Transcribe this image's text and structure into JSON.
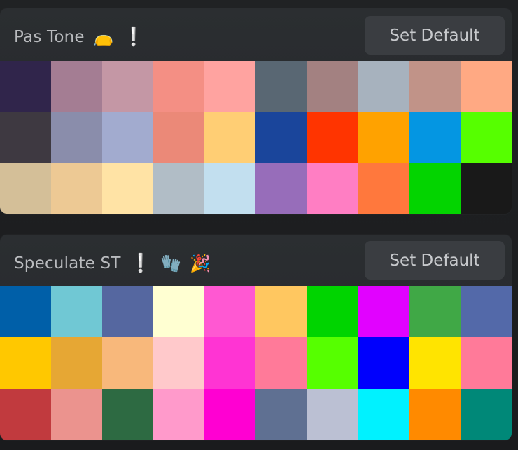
{
  "palettes": [
    {
      "title": "Pas Tone",
      "icons": [
        {
          "name": "bag-icon",
          "glyph": "👝"
        },
        {
          "name": "exclamation-icon",
          "glyph": "❕"
        }
      ],
      "button_label": "Set Default",
      "colors": [
        "#30254b",
        "#a47d93",
        "#c497a5",
        "#f48f84",
        "#ffa3a0",
        "#596773",
        "#a38181",
        "#a7b2be",
        "#c19388",
        "#ffa983",
        "#3e3941",
        "#8a8dab",
        "#a2abcf",
        "#eb8978",
        "#ffce74",
        "#1a459b",
        "#ff3400",
        "#ffa200",
        "#0496e2",
        "#56ff00",
        "#d4bf98",
        "#edc994",
        "#ffe3a5",
        "#b1bdc6",
        "#c2dfef",
        "#976dba",
        "#ff7ec3",
        "#ff783d",
        "#03d400",
        "#191919"
      ]
    },
    {
      "title": "Speculate ST",
      "icons": [
        {
          "name": "exclamation-icon",
          "glyph": "❕"
        },
        {
          "name": "glove-icon",
          "glyph": "🧤"
        },
        {
          "name": "party-popper-icon",
          "glyph": "🎉"
        }
      ],
      "button_label": "Set Default",
      "colors": [
        "#005fa8",
        "#70c8d4",
        "#5567a0",
        "#ffffd2",
        "#ff58d2",
        "#ffc760",
        "#00d400",
        "#e102ff",
        "#40a846",
        "#5369a9",
        "#ffc800",
        "#e6a734",
        "#f8b87b",
        "#ffc9cb",
        "#ff34d3",
        "#ff7a99",
        "#56ff00",
        "#0000fd",
        "#ffe400",
        "#ff7a99",
        "#c13a3e",
        "#eb938e",
        "#2d6a42",
        "#ff9acb",
        "#ff00d2",
        "#5f7092",
        "#bbc0d3",
        "#00f2ff",
        "#ff8a00",
        "#008878"
      ]
    }
  ]
}
